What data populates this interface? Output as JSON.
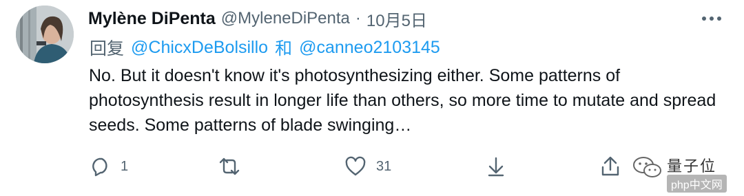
{
  "author": {
    "display_name": "Mylène DiPenta",
    "handle": "@MyleneDiPenta",
    "separator": "·",
    "date": "10月5日"
  },
  "reply_to": {
    "prefix": "回复",
    "mentions": [
      "@ChicxDeBolsillo",
      "@canneo2103145"
    ],
    "conjunction": "和"
  },
  "tweet": {
    "text": "No. But it doesn't know it's photosynthesizing either. Some patterns of photosynthesis result in longer life than others, so more time to mutate and spread seeds. Some patterns of blade swinging…"
  },
  "actions": {
    "reply": {
      "icon": "reply-icon",
      "count": "1"
    },
    "retweet": {
      "icon": "retweet-icon",
      "count": ""
    },
    "like": {
      "icon": "heart-icon",
      "count": "31"
    },
    "share": {
      "icon": "download-arrow-icon"
    },
    "upload": {
      "icon": "upload-icon"
    }
  },
  "more": {
    "icon": "more-horizontal-icon"
  },
  "watermark": {
    "brand": "量子位",
    "site": "php中文网"
  },
  "colors": {
    "primary_text": "#0f1419",
    "secondary_text": "#536471",
    "link": "#1d9bf0",
    "icon": "#536471"
  }
}
